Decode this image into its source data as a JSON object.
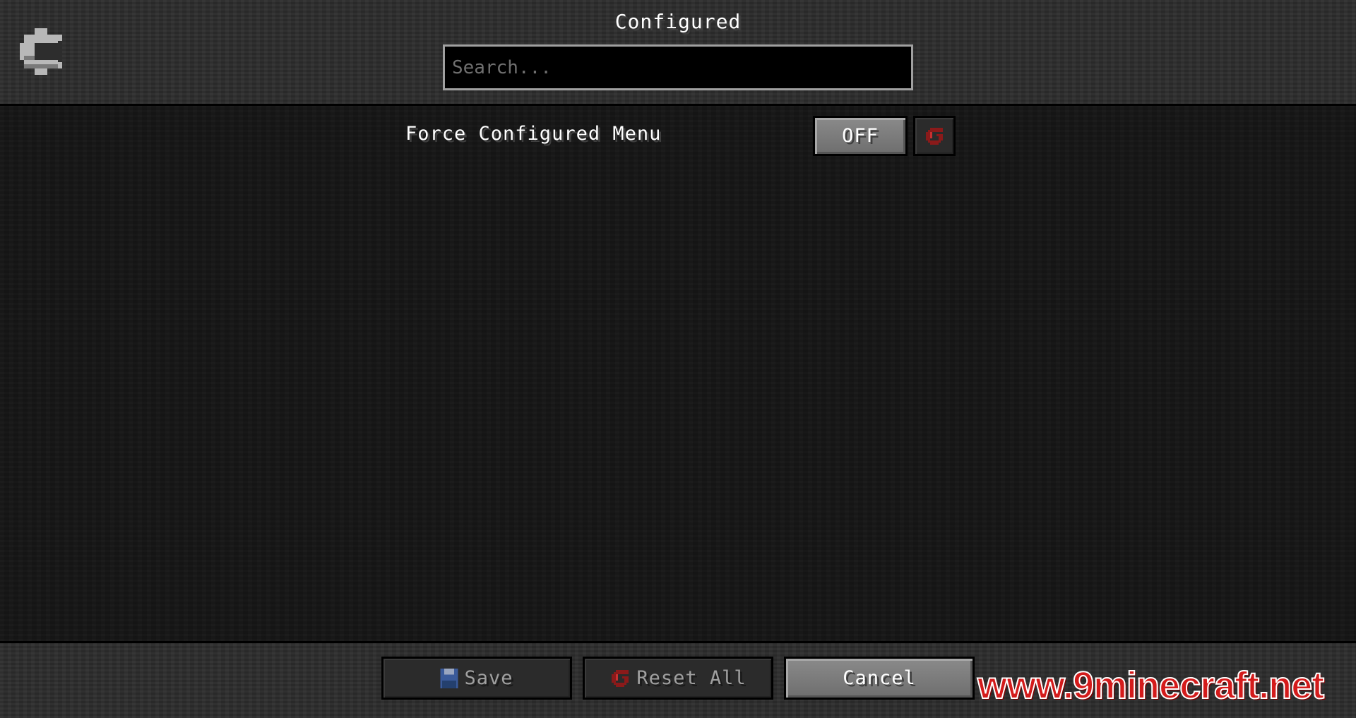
{
  "header": {
    "title": "Configured",
    "search_placeholder": "Search..."
  },
  "config_row": {
    "label": "Force Configured Menu",
    "toggle_value": "OFF"
  },
  "footer": {
    "save_label": "Save",
    "reset_all_label": "Reset All",
    "cancel_label": "Cancel"
  },
  "watermark": "www.9minecraft.net",
  "icons": {
    "logo": "gear-icon",
    "reset": "reset-icon",
    "save": "floppy-disk-icon"
  },
  "colors": {
    "reset_icon": "#8b1a1a",
    "save_icon": "#3a5a9a",
    "watermark": "#d41b1b"
  }
}
